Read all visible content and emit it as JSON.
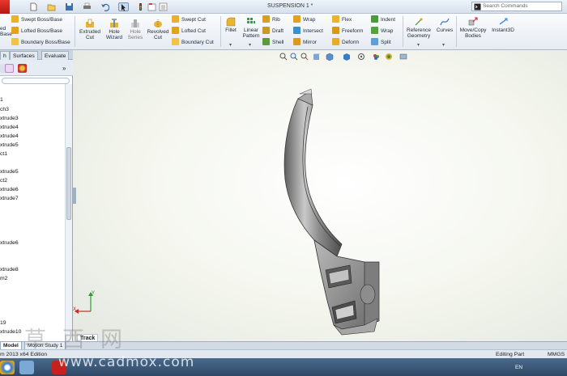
{
  "document": {
    "title": "SUSPENSION 1 *"
  },
  "search": {
    "label": "Search Commands"
  },
  "ribbon": {
    "features_cut_left": {
      "line1": "ed",
      "line2": "Base"
    },
    "boss": [
      "Swept Boss/Base",
      "Lofted Boss/Base",
      "Boundary Boss/Base"
    ],
    "extruded_cut": {
      "line1": "Extruded",
      "line2": "Cut"
    },
    "hole_wizard": {
      "line1": "Hole",
      "line2": "Wizard"
    },
    "hole_series": {
      "line1": "Hole",
      "line2": "Series"
    },
    "revolved_cut": {
      "line1": "Revolved",
      "line2": "Cut"
    },
    "cuts": [
      "Swept Cut",
      "Lofted Cut",
      "Boundary Cut"
    ],
    "fillet": "Fillet",
    "linear_pattern": {
      "line1": "Linear",
      "line2": "Pattern"
    },
    "col_rib": [
      "Rib",
      "Draft",
      "Shell"
    ],
    "col_wrap": [
      "Wrap",
      "Intersect",
      "Mirror"
    ],
    "col_flex": [
      "Flex",
      "Freeform",
      "Deform"
    ],
    "col_indent": [
      "Indent",
      "Wrap",
      "Split"
    ],
    "reference_geometry": {
      "line1": "Reference",
      "line2": "Geometry"
    },
    "curves": "Curves",
    "move_copy": {
      "line1": "Move/Copy",
      "line2": "Bodies"
    },
    "instant3d": "Instant3D"
  },
  "feature_tabs": [
    "h",
    "Surfaces",
    "Evaluate"
  ],
  "tree": {
    "items": [
      "1",
      "ch3",
      "xtrude3",
      "xtrude4",
      "xtrude4",
      "xtrude5",
      "ct1",
      "xtrude5",
      "ct2",
      "xtrude6",
      "xtrude7",
      "xtrude6",
      "xtrude8",
      "m2",
      "19",
      "xtrude10"
    ]
  },
  "bottom_tabs": [
    "Model",
    "Motion Study 1"
  ],
  "track_tag": "Track",
  "status": {
    "left": "m 2013 x64 Edition",
    "mode": "Editing Part",
    "units": "MMGS"
  },
  "triad": {
    "x": "X",
    "y": "Y"
  },
  "taskbar": {
    "lang": "EN"
  },
  "watermark": {
    "url": "www.cadmox.com",
    "cjk": "草西网"
  },
  "colors": {
    "ribbon_bg": "#f1f4f8",
    "viewport_bg": "#f4f6ee",
    "part_fill": "#9a9a9a",
    "brand_red": "#c8201a"
  }
}
